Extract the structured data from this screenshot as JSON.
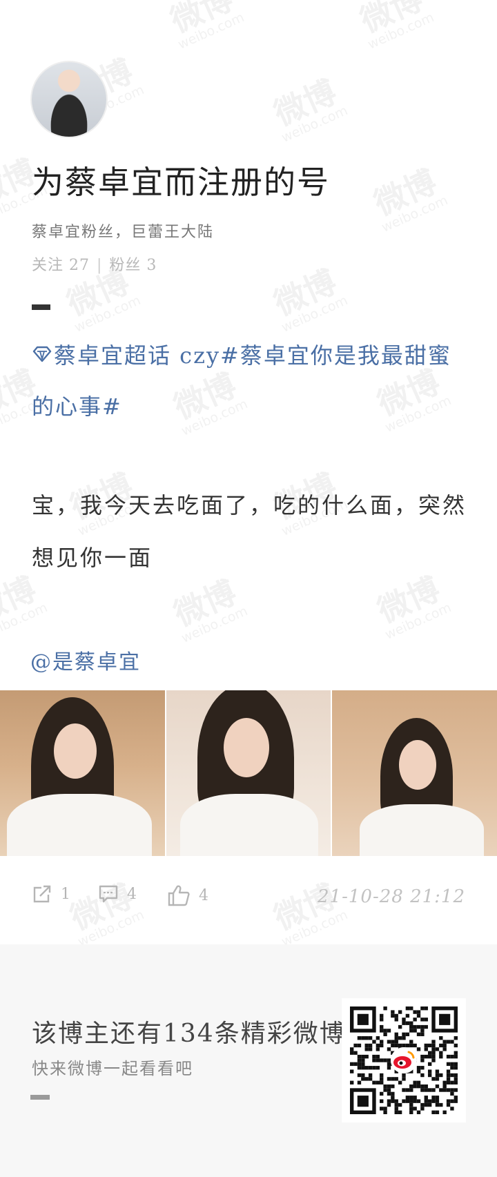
{
  "watermark": {
    "text": "微博",
    "domain": "weibo.com"
  },
  "profile": {
    "avatar_name": "avatar",
    "title": "为蔡卓宜而注册的号",
    "subtitle": "蔡卓宜粉丝，巨蕾王大陆",
    "following_label": "关注 27",
    "followers_label": "粉丝 3"
  },
  "post": {
    "topic_text": "蔡卓宜超话 czy#蔡卓宜你是我最甜蜜的心事#",
    "body": "宝，我今天去吃面了，吃的什么面，突然想见你一面",
    "mention": "@是蔡卓宜",
    "images": [
      "photo-1",
      "photo-2",
      "photo-3"
    ]
  },
  "actions": {
    "share_count": "1",
    "comment_count": "4",
    "like_count": "4",
    "timestamp": "21-10-28 21:12"
  },
  "footer": {
    "title": "该博主还有134条精彩微博",
    "subtitle": "快来微博一起看看吧"
  },
  "colors": {
    "link": "#4a6fa5",
    "muted": "#b5b5b5",
    "weibo_red": "#e6162d",
    "weibo_orange": "#ff9a00"
  },
  "icons": [
    "diamond-icon",
    "share-icon",
    "comment-icon",
    "like-icon",
    "weibo-logo-icon"
  ]
}
